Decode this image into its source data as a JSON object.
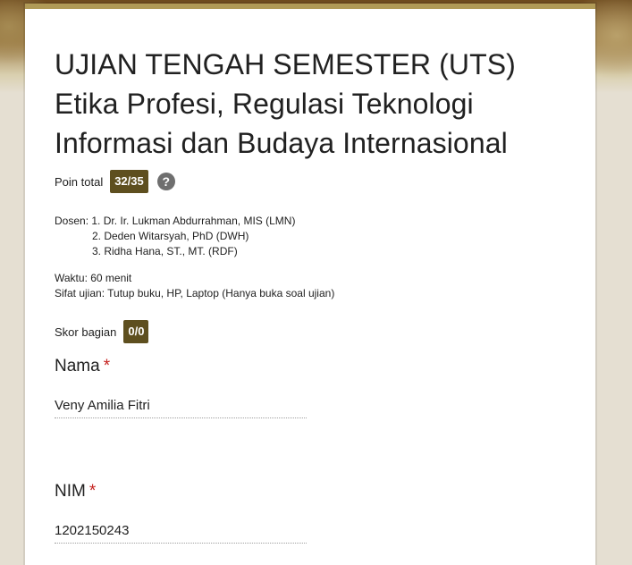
{
  "form": {
    "title_line1": "UJIAN TENGAH SEMESTER (UTS)",
    "title_line2": "Etika Profesi, Regulasi Teknologi",
    "title_line3": "Informasi dan Budaya Internasional",
    "total_points_label": "Poin total",
    "total_points_value": "32/35",
    "help_icon_glyph": "?"
  },
  "description": {
    "dosen_line1": "Dosen: 1. Dr. Ir. Lukman Abdurrahman, MIS (LMN)",
    "dosen_line2": "2. Deden Witarsyah, PhD (DWH)",
    "dosen_line3": "3. Ridha Hana, ST., MT. (RDF)",
    "waktu": "Waktu: 60 menit",
    "sifat": "Sifat ujian: Tutup buku, HP, Laptop (Hanya buka soal ujian)"
  },
  "section": {
    "score_label": "Skor bagian",
    "score_value": "0/0"
  },
  "questions": [
    {
      "label": "Nama",
      "required_mark": "*",
      "answer": "Veny Amilia Fitri"
    },
    {
      "label": "NIM",
      "required_mark": "*",
      "answer": "1202150243"
    }
  ],
  "colors": {
    "accent": "#b09a57",
    "badge": "#5e4f1f",
    "required": "#c5221f",
    "background": "#e5dfd2"
  }
}
